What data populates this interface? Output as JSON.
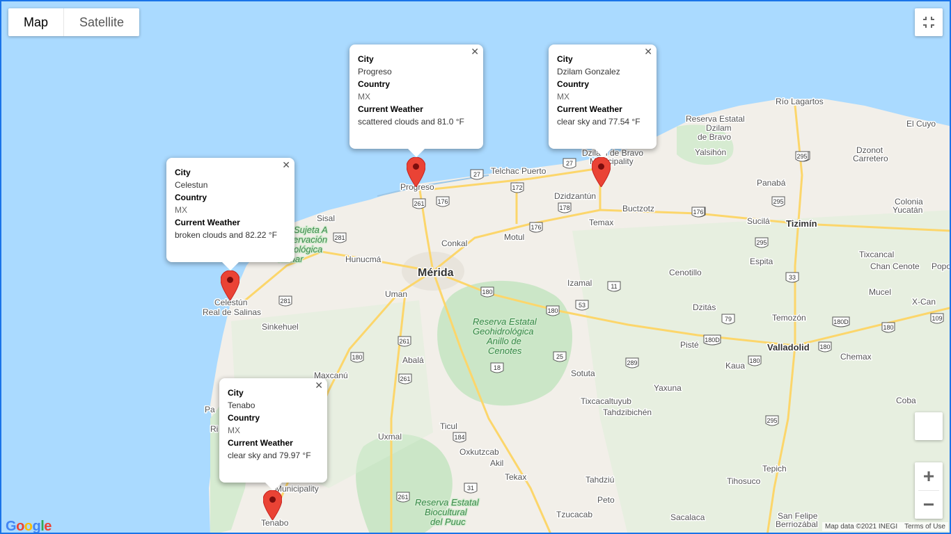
{
  "map_type": {
    "map": "Map",
    "satellite": "Satellite",
    "active": "map"
  },
  "controls": {
    "fullscreen": "fullscreen-exit-icon",
    "zoom_in": "+",
    "zoom_out": "−"
  },
  "colors": {
    "water": "#aadaff",
    "land": "#f2efe9",
    "park": "#cbe6c7",
    "highway": "#fcd66b",
    "marker": "#ea4335",
    "frame": "#1a73e8"
  },
  "places": [
    {
      "name": "Progreso"
    },
    {
      "name": "Telchac Puerto"
    },
    {
      "name": "Dzilam de Bravo"
    },
    {
      "name": "Municipality"
    },
    {
      "name": "Río Lagartos"
    },
    {
      "name": "El Cuyo"
    },
    {
      "name": "Reserva Estatal"
    },
    {
      "name": "Dzilam"
    },
    {
      "name": "de Bravo"
    },
    {
      "name": "Yalsihón"
    },
    {
      "name": "Dzonot"
    },
    {
      "name": "Carretero"
    },
    {
      "name": "Dzidzantún"
    },
    {
      "name": "Buctzotz"
    },
    {
      "name": "Temax"
    },
    {
      "name": "Panabá"
    },
    {
      "name": "Colonia"
    },
    {
      "name": "Yucatán"
    },
    {
      "name": "Sucilá"
    },
    {
      "name": "Tizimín"
    },
    {
      "name": "Sisal"
    },
    {
      "name": "Conkal"
    },
    {
      "name": "Motul"
    },
    {
      "name": "Hunucmá"
    },
    {
      "name": "Mérida"
    },
    {
      "name": "Uman"
    },
    {
      "name": "Izamal"
    },
    {
      "name": "Cenotillo"
    },
    {
      "name": "Espita"
    },
    {
      "name": "Tixcancal"
    },
    {
      "name": "Chan Cenote"
    },
    {
      "name": "Popo"
    },
    {
      "name": "Mucel"
    },
    {
      "name": "X-Can"
    },
    {
      "name": "Celestún"
    },
    {
      "name": "Real de Salinas"
    },
    {
      "name": "Sinkehuel"
    },
    {
      "name": "Reserva Estatal"
    },
    {
      "name": "Geohidrológica"
    },
    {
      "name": "Anillo de"
    },
    {
      "name": "Cenotes"
    },
    {
      "name": "Dzitás"
    },
    {
      "name": "Temozón"
    },
    {
      "name": "Pisté"
    },
    {
      "name": "Valladolid"
    },
    {
      "name": "Kaua"
    },
    {
      "name": "Chemax"
    },
    {
      "name": "Maxcanú"
    },
    {
      "name": "Abalá"
    },
    {
      "name": "Sotuta"
    },
    {
      "name": "Yaxuna"
    },
    {
      "name": "Tixcacaltuyub"
    },
    {
      "name": "Tahdzibichén"
    },
    {
      "name": "Coba"
    },
    {
      "name": "Ticul"
    },
    {
      "name": "Uxmal"
    },
    {
      "name": "Oxkutzcab"
    },
    {
      "name": "Akil"
    },
    {
      "name": "Tekax"
    },
    {
      "name": "Tahdziú"
    },
    {
      "name": "Tepich"
    },
    {
      "name": "Tihosuco"
    },
    {
      "name": "Peto"
    },
    {
      "name": "Tzucacab"
    },
    {
      "name": "Reserva Estatal"
    },
    {
      "name": "Biocultural"
    },
    {
      "name": "del Puuc"
    },
    {
      "name": "Sacalaca"
    },
    {
      "name": "San Felipe"
    },
    {
      "name": "Berriozábal"
    },
    {
      "name": "Tenabo"
    },
    {
      "name": "Municipality"
    },
    {
      "name": "Sujeta A"
    },
    {
      "name": "ervación"
    },
    {
      "name": "ológica"
    },
    {
      "name": "lalmar"
    },
    {
      "name": "Pa"
    },
    {
      "name": "Ri"
    }
  ],
  "shields": [
    "27",
    "27",
    "172",
    "176",
    "261",
    "176",
    "178",
    "176",
    "176",
    "176",
    "295",
    "295",
    "33",
    "295",
    "281",
    "281",
    "180",
    "11",
    "53",
    "180",
    "79",
    "180D",
    "180D",
    "109",
    "180",
    "261",
    "180",
    "25",
    "18",
    "289",
    "180",
    "180",
    "261",
    "184",
    "31",
    "261",
    "295"
  ],
  "infowindows": [
    {
      "city_label": "City",
      "city": "Progreso",
      "country_label": "Country",
      "country": "MX",
      "weather_label": "Current Weather",
      "weather": "scattered clouds and 81.0 °F"
    },
    {
      "city_label": "City",
      "city": "Dzilam Gonzalez",
      "country_label": "Country",
      "country": "MX",
      "weather_label": "Current Weather",
      "weather": "clear sky and 77.54 °F"
    },
    {
      "city_label": "City",
      "city": "Celestun",
      "country_label": "Country",
      "country": "MX",
      "weather_label": "Current Weather",
      "weather": "broken clouds and 82.22 °F"
    },
    {
      "city_label": "City",
      "city": "Tenabo",
      "country_label": "Country",
      "country": "MX",
      "weather_label": "Current Weather",
      "weather": "clear sky and 79.97 °F"
    }
  ],
  "footer": {
    "logo": "Google",
    "map_data": "Map data ©2021 INEGI",
    "terms": "Terms of Use"
  }
}
